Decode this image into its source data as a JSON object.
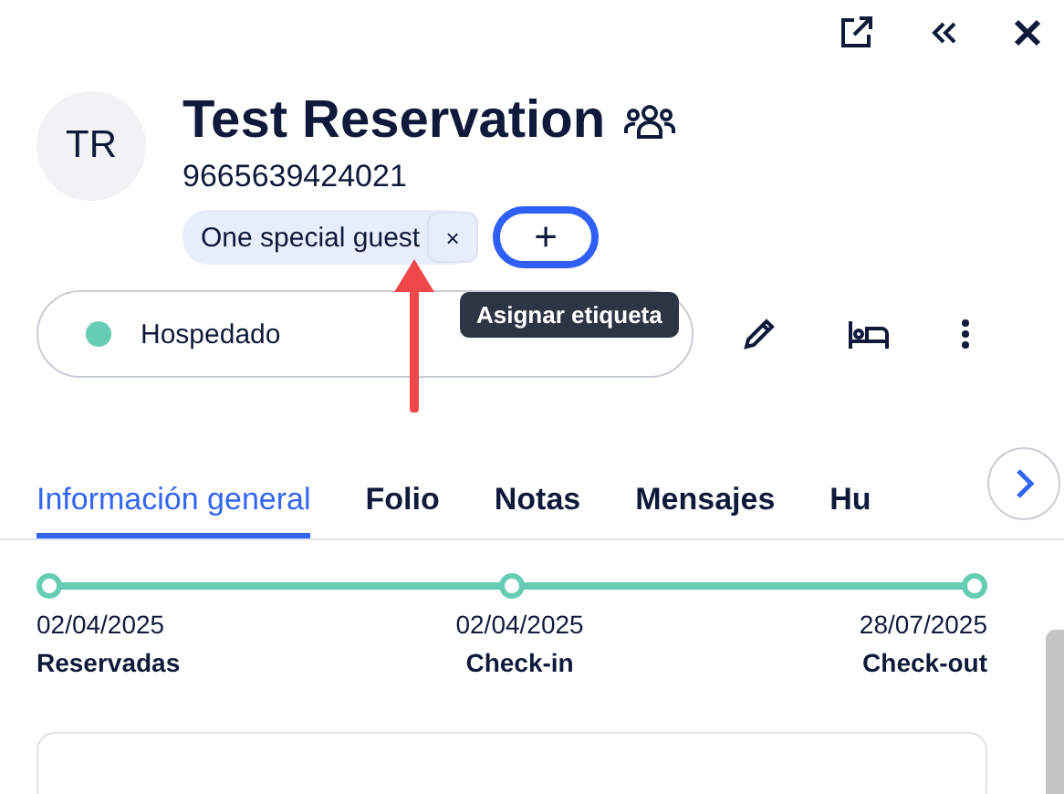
{
  "header": {
    "avatar_initials": "TR",
    "title": "Test Reservation",
    "reservation_number": "9665639424021"
  },
  "tags": [
    {
      "label": "One special guest",
      "remove": "×"
    }
  ],
  "add_tag": {
    "label": "+",
    "focused": true,
    "tooltip": "Asignar etiqueta"
  },
  "status": {
    "label": "Hospedado",
    "color": "#66cdb4"
  },
  "tabs": [
    {
      "label": "Información general",
      "selected": true
    },
    {
      "label": "Folio",
      "selected": false
    },
    {
      "label": "Notas",
      "selected": false
    },
    {
      "label": "Mensajes",
      "selected": false
    },
    {
      "label": "Hu",
      "selected": false
    }
  ],
  "timeline": [
    {
      "date": "02/04/2025",
      "label": "Reservadas"
    },
    {
      "date": "02/04/2025",
      "label": "Check-in"
    },
    {
      "date": "28/07/2025",
      "label": "Check-out"
    }
  ]
}
